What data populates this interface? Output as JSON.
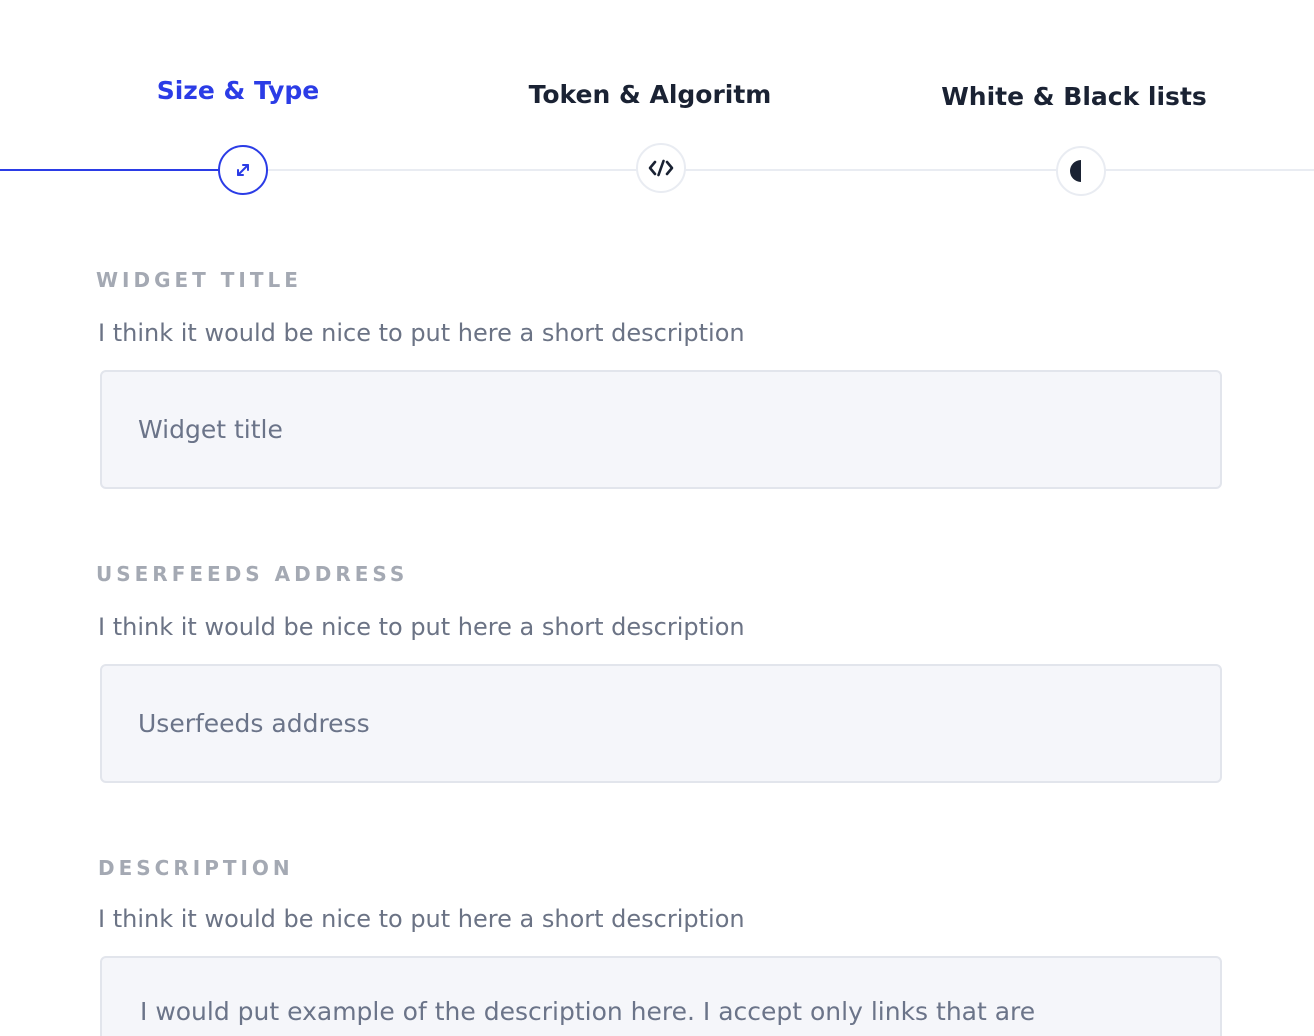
{
  "stepper": {
    "steps": [
      {
        "label": "Size & Type",
        "icon": "resize-arrows-icon",
        "active": true
      },
      {
        "label": "Token & Algoritm",
        "icon": "code-icon",
        "active": false
      },
      {
        "label": "White & Black lists",
        "icon": "half-circle-icon",
        "active": false
      }
    ],
    "colors": {
      "active": "#2b3ce6",
      "inactive": "#1a2233",
      "track": "#e9ecf2"
    }
  },
  "form": {
    "widget_title": {
      "label": "WIDGET TITLE",
      "description": "I think it would be nice to put here a short description",
      "placeholder": "Widget title"
    },
    "userfeeds_address": {
      "label": "USERFEEDS ADDRESS",
      "description": "I think it would be nice to put here a short description",
      "placeholder": "Userfeeds address"
    },
    "description": {
      "label": "DESCRIPTION",
      "description": "I think it would be nice to put here a short description",
      "placeholder": "I would put example of the description here. I accept only links that are"
    }
  }
}
